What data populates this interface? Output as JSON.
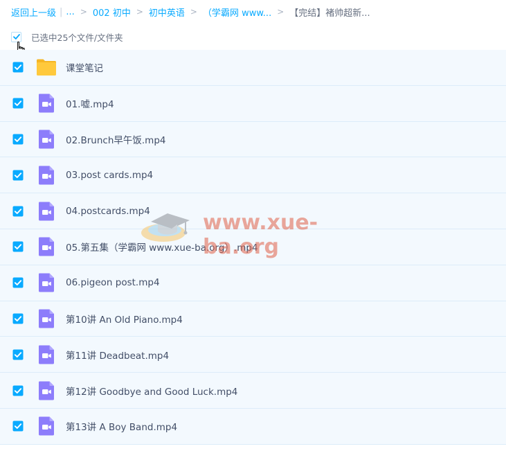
{
  "breadcrumb": {
    "back": "返回上一级",
    "ellipsis": "...",
    "items": [
      "002 初中",
      "初中英语",
      "（学霸网 www...",
      "【完结】褚帅超新..."
    ]
  },
  "selection": {
    "label": "已选中25个文件/文件夹"
  },
  "files": [
    {
      "name": "课堂笔记",
      "type": "folder"
    },
    {
      "name": "01.嘘.mp4",
      "type": "video"
    },
    {
      "name": "02.Brunch早午饭.mp4",
      "type": "video"
    },
    {
      "name": "03.post cards.mp4",
      "type": "video"
    },
    {
      "name": "04.postcards.mp4",
      "type": "video"
    },
    {
      "name": "05.第五集（学霸网 www.xue-ba.org）.mp4",
      "type": "video"
    },
    {
      "name": "06.pigeon post.mp4",
      "type": "video"
    },
    {
      "name": "第10讲 An Old Piano.mp4",
      "type": "video"
    },
    {
      "name": "第11讲 Deadbeat.mp4",
      "type": "video"
    },
    {
      "name": "第12讲 Goodbye and Good Luck.mp4",
      "type": "video"
    },
    {
      "name": "第13讲 A Boy Band.mp4",
      "type": "video"
    }
  ],
  "watermark": {
    "text": "www.xue-ba.org"
  },
  "colors": {
    "accent": "#09aaff",
    "row_bg": "#f3f9fe",
    "folder": "#ffc93c",
    "video": "#8d7dfb"
  }
}
